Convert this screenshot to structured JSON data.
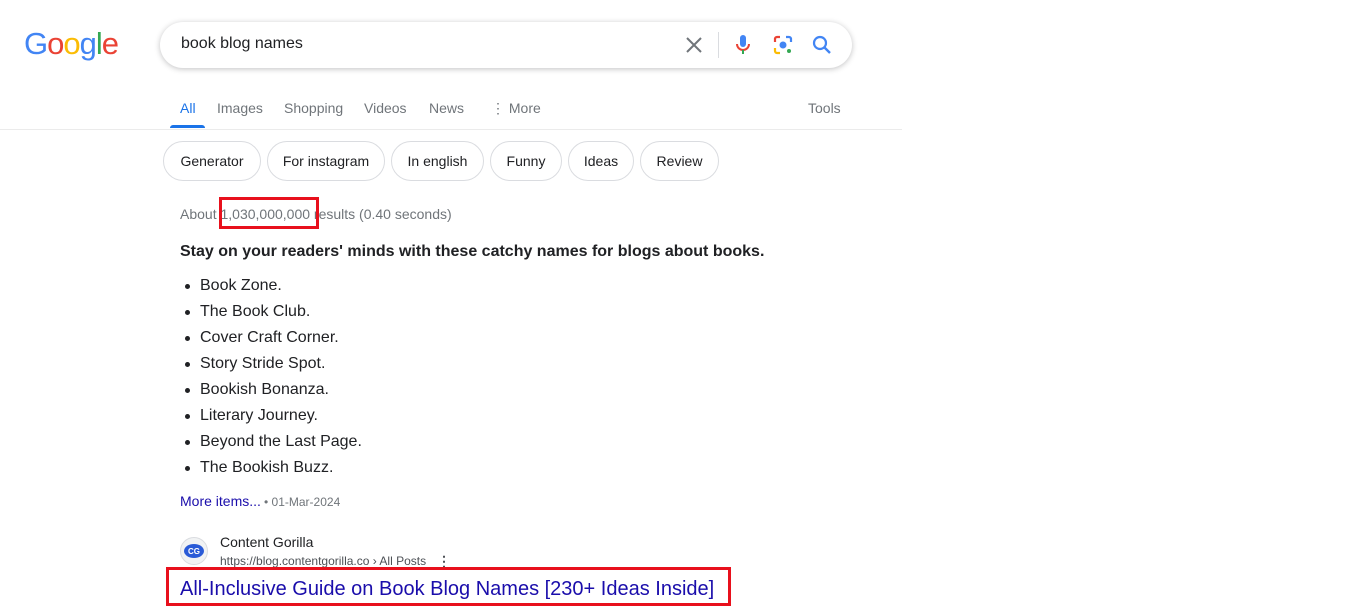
{
  "logo": {
    "text": "Google",
    "colors": [
      "#4285f4",
      "#ea4335",
      "#fbbc05",
      "#4285f4",
      "#34a853",
      "#ea4335"
    ]
  },
  "search": {
    "query": "book blog names",
    "icons": [
      "close-icon",
      "microphone-icon",
      "lens-icon",
      "search-icon"
    ]
  },
  "tabs": [
    {
      "label": "All",
      "active": true
    },
    {
      "label": "Images"
    },
    {
      "label": "Shopping"
    },
    {
      "label": "Videos"
    },
    {
      "label": "News"
    },
    {
      "label": "More"
    },
    {
      "label": "Tools"
    }
  ],
  "chips": [
    "Generator",
    "For instagram",
    "In english",
    "Funny",
    "Ideas",
    "Review"
  ],
  "stats": {
    "prefix": "About ",
    "count": "1,030,000,000",
    "suffix": " results (0.40 seconds)"
  },
  "snippet": {
    "heading": "Stay on your readers' minds with these catchy names for blogs about books.",
    "items": [
      "Book Zone.",
      "The Book Club.",
      "Cover Craft Corner.",
      "Story Stride Spot.",
      "Bookish Bonanza.",
      "Literary Journey.",
      "Beyond the Last Page.",
      "The Bookish Buzz."
    ],
    "more": "More items...",
    "date": "01-Mar-2024"
  },
  "result": {
    "favicon": "CG",
    "site": "Content Gorilla",
    "url": "https://blog.contentgorilla.co › All Posts",
    "title": "All-Inclusive Guide on Book Blog Names [230+ Ideas Inside]"
  },
  "colors": {
    "accent": "#1a73e8",
    "link": "#1a0dab",
    "highlight_box": "#e8101c"
  }
}
